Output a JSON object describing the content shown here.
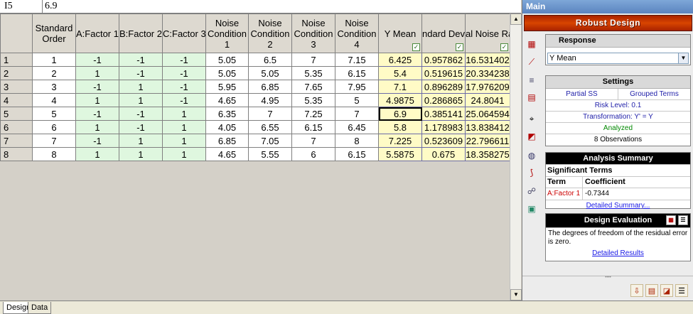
{
  "formula_bar": {
    "cell_ref": "I5",
    "value": "6.9"
  },
  "grid": {
    "headers": [
      "Standard Order",
      "A:Factor 1",
      "B:Factor 2",
      "C:Factor 3",
      "Noise Condition 1",
      "Noise Condition 2",
      "Noise Condition 3",
      "Noise Condition 4",
      "Y Mean",
      "ndard Devia",
      "al Noise Ra"
    ],
    "rows": [
      [
        "1",
        "1",
        "-1",
        "-1",
        "-1",
        "5.05",
        "6.5",
        "7",
        "7.15",
        "6.425",
        "0.957862",
        "16.531402"
      ],
      [
        "2",
        "2",
        "1",
        "-1",
        "-1",
        "5.05",
        "5.05",
        "5.35",
        "6.15",
        "5.4",
        "0.519615",
        "20.334238"
      ],
      [
        "3",
        "3",
        "-1",
        "1",
        "-1",
        "5.95",
        "6.85",
        "7.65",
        "7.95",
        "7.1",
        "0.896289",
        "17.976209"
      ],
      [
        "4",
        "4",
        "1",
        "1",
        "-1",
        "4.65",
        "4.95",
        "5.35",
        "5",
        "4.9875",
        "0.286865",
        "24.8041"
      ],
      [
        "5",
        "5",
        "-1",
        "-1",
        "1",
        "6.35",
        "7",
        "7.25",
        "7",
        "6.9",
        "0.385141",
        "25.064594"
      ],
      [
        "6",
        "6",
        "1",
        "-1",
        "1",
        "4.05",
        "6.55",
        "6.15",
        "6.45",
        "5.8",
        "1.178983",
        "13.838412"
      ],
      [
        "7",
        "7",
        "-1",
        "1",
        "1",
        "6.85",
        "7.05",
        "7",
        "8",
        "7.225",
        "0.523609",
        "22.796611"
      ],
      [
        "8",
        "8",
        "1",
        "1",
        "1",
        "4.65",
        "5.55",
        "6",
        "6.15",
        "5.5875",
        "0.675",
        "18.358275"
      ]
    ]
  },
  "tabs": [
    "Design",
    "Data"
  ],
  "panel": {
    "title": "Main",
    "banner": "Robust Design",
    "response": {
      "label": "Response",
      "selected": "Y Mean"
    },
    "settings": {
      "label": "Settings",
      "partial_ss": "Partial SS",
      "grouped_terms": "Grouped Terms",
      "risk_level": "Risk Level: 0.1",
      "transformation": "Transformation: Y' = Y",
      "status": "Analyzed",
      "observations": "8 Observations"
    },
    "analysis_summary": {
      "label": "Analysis Summary",
      "significant_terms": "Significant Terms",
      "col_term": "Term",
      "col_coefficient": "Coefficient",
      "term": "A:Factor 1",
      "coefficient": "-0.7344",
      "link": "Detailed Summary..."
    },
    "design_evaluation": {
      "label": "Design Evaluation",
      "text": "The degrees of freedom of the residual error is zero.",
      "link": "Detailed Results"
    }
  },
  "colors": {
    "factor_cell": "#dff7df",
    "response_cell": "#fffbc6",
    "banner": "#d84500"
  },
  "icons": {
    "toolbar": [
      "anova-table-icon",
      "regression-plot-icon",
      "chart-icon",
      "pareto-icon",
      "target-icon",
      "residual-plot-icon",
      "globe-icon",
      "line-plot-icon",
      "optimize-icon",
      "worksheet-icon"
    ],
    "bottom": [
      "export-icon",
      "pdf-icon",
      "report-icon",
      "options-icon"
    ]
  }
}
